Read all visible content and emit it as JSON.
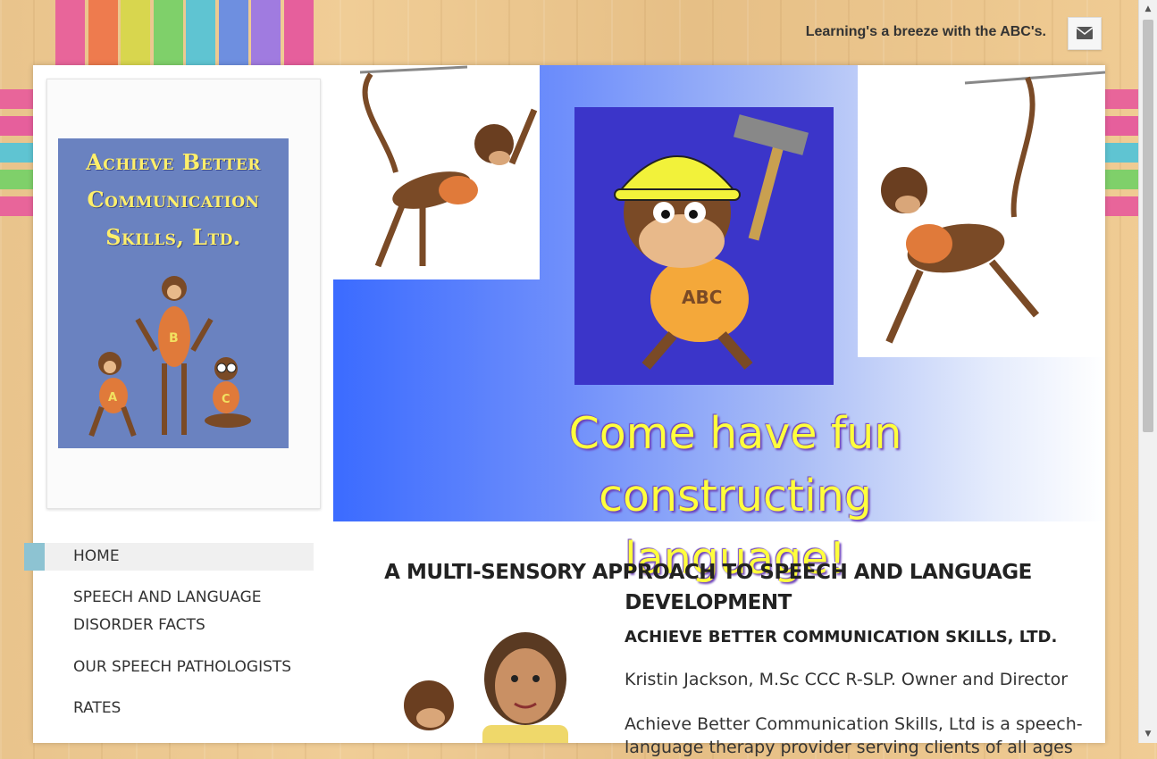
{
  "header": {
    "tagline": "Learning's a breeze with the ABC's.",
    "mail_icon": "mail-icon"
  },
  "logo": {
    "lines": [
      "Achieve Better",
      "Communication",
      "Skills, Ltd."
    ],
    "letters": [
      "A",
      "B",
      "C"
    ]
  },
  "hero": {
    "caption_line1": "Come have fun constructing",
    "caption_line2": "language!",
    "shirt_text": "ABC"
  },
  "nav": {
    "items": [
      {
        "label": "HOME",
        "active": true
      },
      {
        "label": "SPEECH AND LANGUAGE DISORDER FACTS",
        "active": false
      },
      {
        "label": "OUR SPEECH PATHOLOGISTS",
        "active": false
      },
      {
        "label": "RATES",
        "active": false
      }
    ]
  },
  "main": {
    "heading": "A MULTI-SENSORY APPROACH TO SPEECH AND LANGUAGE DEVELOPMENT",
    "company": "ACHIEVE BETTER COMMUNICATION SKILLS, LTD.",
    "owner": "Kristin Jackson, M.Sc CCC R-SLP. Owner and Director",
    "intro": "Achieve Better Communication Skills, Ltd is a speech-language therapy provider serving clients of all ages"
  },
  "colors": {
    "ribbons": [
      "#e8659a",
      "#ee7b4e",
      "#d8d64e",
      "#7fd06a",
      "#5fc4d2",
      "#6e8fe0",
      "#a07be0",
      "#e65f9c"
    ],
    "nav_active_marker": "#8dc3d2"
  }
}
